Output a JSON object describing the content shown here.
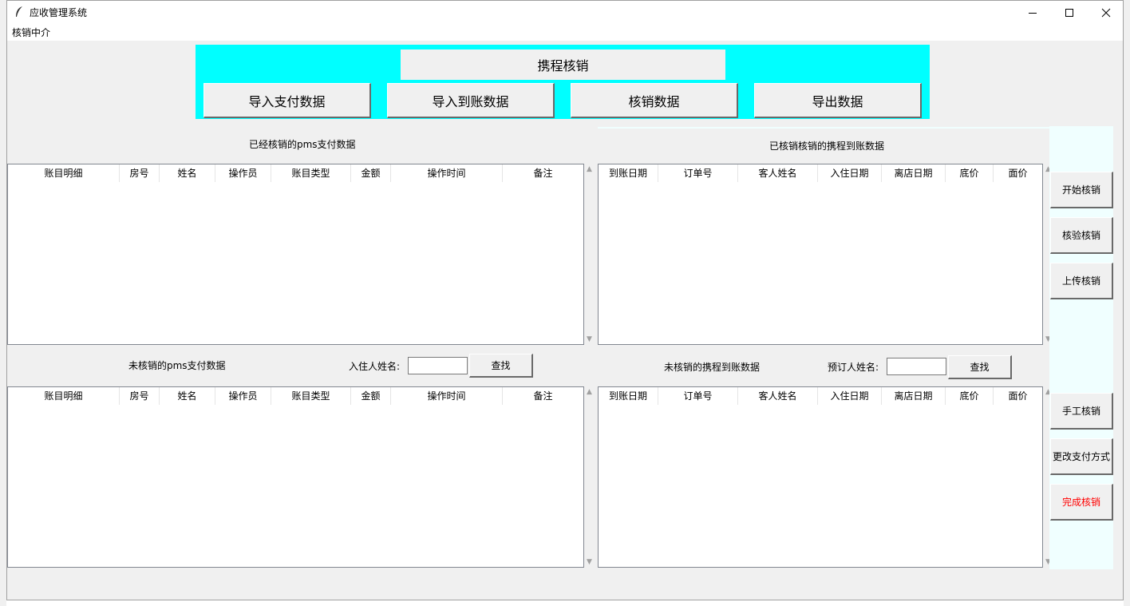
{
  "window": {
    "title": "应收管理系统",
    "menu": [
      "核销中介"
    ]
  },
  "toolbar": {
    "main_label": "携程核销",
    "buttons": [
      "导入支付数据",
      "导入到账数据",
      "核销数据",
      "导出数据"
    ]
  },
  "top_left": {
    "title": "已经核销的pms支付数据",
    "columns": [
      "账目明细",
      "房号",
      "姓名",
      "操作员",
      "账目类型",
      "金额",
      "操作时间",
      "备注"
    ]
  },
  "top_right": {
    "title": "已核销核销的携程到账数据",
    "columns": [
      "到账日期",
      "订单号",
      "客人姓名",
      "入住日期",
      "离店日期",
      "底价",
      "面价"
    ]
  },
  "bottom_left": {
    "title": "未核销的pms支付数据",
    "search_label": "入住人姓名:",
    "search_value": "",
    "search_button": "查找",
    "columns": [
      "账目明细",
      "房号",
      "姓名",
      "操作员",
      "账目类型",
      "金额",
      "操作时间",
      "备注"
    ]
  },
  "bottom_right": {
    "title": "未核销的携程到账数据",
    "search_label": "预订人姓名:",
    "search_value": "",
    "search_button": "查找",
    "columns": [
      "到账日期",
      "订单号",
      "客人姓名",
      "入住日期",
      "离店日期",
      "底价",
      "面价"
    ]
  },
  "side": {
    "start": "开始核销",
    "verify": "核验核销",
    "upload": "上传核销",
    "manual": "手工核销",
    "change_payment": "更改支付方式",
    "finish": "完成核销",
    "finish_color": "#ff0000"
  },
  "colors": {
    "toolbar_bg": "#00ffff",
    "side_panel_bg": "#f0ffff"
  }
}
